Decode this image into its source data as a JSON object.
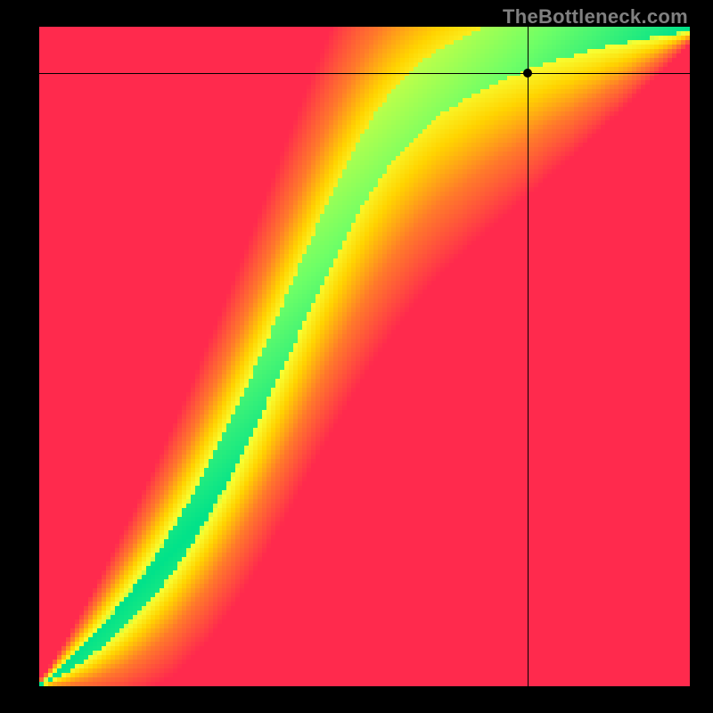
{
  "watermark": "TheBottleneck.com",
  "chart_data": {
    "type": "heatmap",
    "title": "",
    "xlabel": "",
    "ylabel": "",
    "xlim": [
      0,
      100
    ],
    "ylim": [
      0,
      100
    ],
    "x": [
      0,
      1,
      2,
      3,
      4,
      5,
      6,
      7,
      8,
      9,
      10,
      11,
      12,
      13,
      14,
      15,
      16,
      17,
      18,
      19,
      20,
      21,
      22,
      23,
      24,
      25,
      26,
      27,
      28,
      29,
      30,
      31,
      32,
      33,
      34,
      35,
      36,
      37,
      38,
      39,
      40,
      41,
      42,
      43,
      44,
      45,
      46,
      47,
      48,
      49,
      50,
      51,
      52,
      53,
      54,
      55,
      56,
      57,
      58,
      59,
      60,
      61,
      62,
      63,
      64,
      65,
      66,
      67,
      68,
      69,
      70,
      71,
      72,
      73,
      74,
      75,
      76,
      77,
      78,
      79,
      80,
      81,
      82,
      83,
      84,
      85,
      86,
      87,
      88,
      89,
      90,
      91,
      92,
      93,
      94,
      95,
      96,
      97,
      98,
      99,
      100
    ],
    "ideal_curve_y": [
      0,
      0.6,
      1.3,
      2.0,
      2.7,
      3.5,
      4.3,
      5.1,
      6.0,
      6.9,
      7.9,
      8.9,
      9.9,
      11.0,
      12.1,
      13.3,
      14.5,
      15.8,
      17.1,
      18.5,
      19.9,
      21.4,
      23.0,
      24.6,
      26.3,
      28.0,
      29.8,
      31.6,
      33.5,
      35.4,
      37.4,
      39.4,
      41.5,
      43.6,
      45.7,
      47.9,
      50.1,
      52.3,
      54.5,
      56.7,
      58.9,
      61.1,
      63.3,
      65.4,
      67.5,
      69.6,
      71.6,
      73.5,
      75.4,
      77.2,
      78.9,
      80.5,
      82.0,
      83.4,
      84.7,
      85.9,
      87.0,
      88.0,
      89.0,
      89.8,
      90.6,
      91.4,
      92.1,
      92.7,
      93.3,
      93.8,
      94.3,
      94.8,
      95.3,
      95.7,
      96.1,
      96.5,
      96.8,
      97.1,
      97.4,
      97.7,
      98.0,
      98.2,
      98.4,
      98.6,
      98.8,
      99.0,
      99.1,
      99.3,
      99.4,
      99.5,
      99.6,
      99.7,
      99.8,
      99.8,
      99.9,
      99.9,
      100.0,
      100.0,
      100.0,
      100.0,
      100.0,
      100.0,
      100.0,
      100.0,
      100.0
    ],
    "band_half_width_y": [
      0.3,
      0.5,
      0.8,
      1.1,
      1.4,
      1.7,
      2.0,
      2.3,
      2.6,
      2.9,
      3.2,
      3.5,
      3.8,
      4.1,
      4.3,
      4.6,
      4.9,
      5.1,
      5.4,
      5.6,
      5.9,
      6.1,
      6.3,
      6.5,
      6.7,
      7.0,
      7.2,
      7.3,
      7.5,
      7.7,
      7.9,
      8.0,
      8.2,
      8.3,
      8.5,
      8.6,
      8.7,
      8.9,
      9.0,
      9.1,
      9.2,
      9.3,
      9.4,
      9.5,
      9.6,
      9.7,
      9.8,
      9.9,
      9.9,
      10.0,
      10.0,
      10.0,
      10.0,
      10.0,
      9.9,
      9.9,
      9.8,
      9.7,
      9.6,
      9.5,
      9.4,
      9.3,
      9.2,
      9.1,
      9.0,
      8.9,
      8.7,
      8.6,
      8.5,
      8.3,
      8.2,
      8.0,
      7.9,
      7.7,
      7.5,
      7.3,
      7.2,
      7.0,
      6.7,
      6.5,
      6.3,
      6.1,
      5.9,
      5.6,
      5.4,
      5.1,
      4.9,
      4.6,
      4.3,
      4.1,
      3.8,
      3.5,
      3.2,
      2.9,
      2.6,
      2.3,
      2.0,
      1.7,
      1.4,
      1.1,
      0.8
    ],
    "marker": {
      "x": 75,
      "y": 93
    },
    "crosshair": {
      "x": 75,
      "y": 93
    },
    "color_stops": [
      {
        "t": 0.0,
        "color": "#ff2a4d"
      },
      {
        "t": 0.35,
        "color": "#ff7a2a"
      },
      {
        "t": 0.6,
        "color": "#ffd400"
      },
      {
        "t": 0.78,
        "color": "#f7ff33"
      },
      {
        "t": 0.9,
        "color": "#6fff66"
      },
      {
        "t": 1.0,
        "color": "#00e28a"
      }
    ],
    "grid": false,
    "legend": null
  }
}
